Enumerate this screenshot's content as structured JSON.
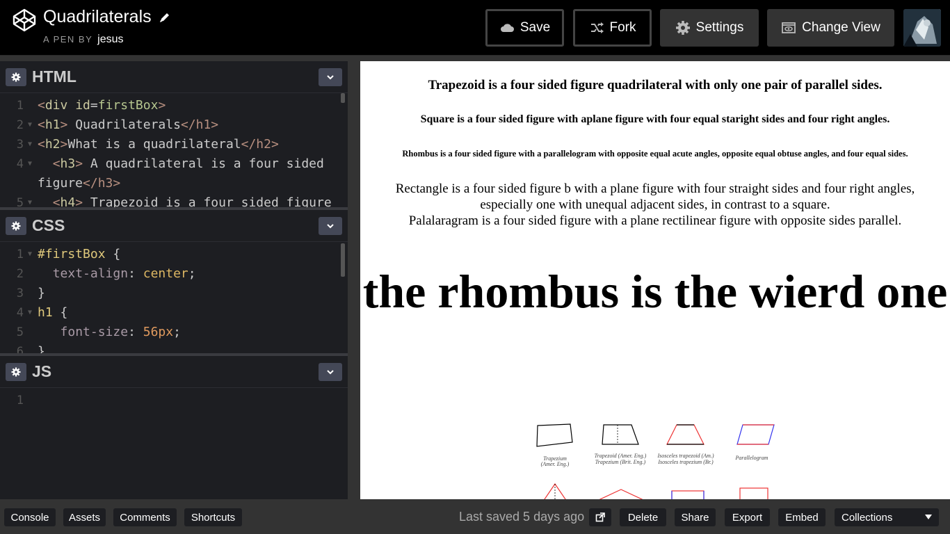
{
  "header": {
    "pen_title": "Quadrilaterals",
    "pen_by_label": "A PEN BY",
    "author": "jesus",
    "buttons": {
      "save": "Save",
      "fork": "Fork",
      "settings": "Settings",
      "change_view": "Change View"
    },
    "icons": {
      "logo": "codepen-logo-icon",
      "edit": "pencil-icon",
      "save": "cloud-icon",
      "fork": "fork-icon",
      "settings": "gear-icon",
      "change_view": "eye-window-icon"
    }
  },
  "panes": {
    "html": {
      "title": "HTML",
      "lines": [
        {
          "n": "1",
          "fold": "",
          "text": "<div id=firstBox>"
        },
        {
          "n": "2",
          "fold": "▼",
          "text": "<h1> Quadrilaterals</h1>"
        },
        {
          "n": "3",
          "fold": "▼",
          "text": "<h2>What is a quadrilateral</h2>"
        },
        {
          "n": "4",
          "fold": "▼",
          "text": "  <h3> A quadrilateral is a four sided figure</h3>"
        },
        {
          "n": "5",
          "fold": "▼",
          "text": "  <h4> Trapezoid is a four sided figure"
        }
      ]
    },
    "css": {
      "title": "CSS",
      "lines": [
        {
          "n": "1",
          "fold": "▼",
          "text": "#firstBox {"
        },
        {
          "n": "2",
          "fold": "",
          "text": "  text-align: center;"
        },
        {
          "n": "3",
          "fold": "",
          "text": "}"
        },
        {
          "n": "4",
          "fold": "▼",
          "text": "h1 {"
        },
        {
          "n": "5",
          "fold": "",
          "text": "   font-size: 56px;"
        },
        {
          "n": "6",
          "fold": "",
          "text": "}"
        }
      ]
    },
    "js": {
      "title": "JS",
      "lines": [
        {
          "n": "1",
          "fold": "",
          "text": ""
        }
      ]
    }
  },
  "preview": {
    "trapezoid": "Trapezoid is a four sided figure quadrilateral with only one pair of parallel sides.",
    "square": "Square is a four sided figure with aplane figure with four equal staright sides and four right angles.",
    "rhombus": "Rhombus is a four sided figure with a parallelogram with opposite equal acute angles, opposite equal obtuse angles, and four equal sides.",
    "rectangle": "Rectangle is a four sided figure b with a plane figure with four straight sides and four right angles, especially one with unequal adjacent sides, in contrast to a square.",
    "parallelogram": "Palalaragram is a four sided figure with a plane rectilinear figure with opposite sides parallel.",
    "headline": "the rhombus is the wierd one",
    "figure_captions": {
      "trapezium_1": "Trapezium",
      "trapezium_1b": "(Amer. Eng.)",
      "trapezoid_1": "Trapezoid (Amer. Eng.)",
      "trapezoid_1b": "Trapezium (Brit. Eng.)",
      "isosceles_1": "Isosceles trapezoid (Am.)",
      "isosceles_1b": "Isosceles trapezium (Br.)",
      "parallelogram": "Parallelogram"
    }
  },
  "footer": {
    "console": "Console",
    "assets": "Assets",
    "comments": "Comments",
    "shortcuts": "Shortcuts",
    "last_saved": "Last saved 5 days ago",
    "delete": "Delete",
    "share": "Share",
    "export": "Export",
    "embed": "Embed",
    "collections": "Collections",
    "icons": {
      "open_external": "external-link-icon",
      "collections_dropdown": "caret-down-icon"
    }
  },
  "colors": {
    "header_bg": "#000000",
    "editor_bg": "#1d1e22",
    "button_bg": "#333333",
    "preview_bg": "#ffffff",
    "footer_bg": "#333333"
  }
}
